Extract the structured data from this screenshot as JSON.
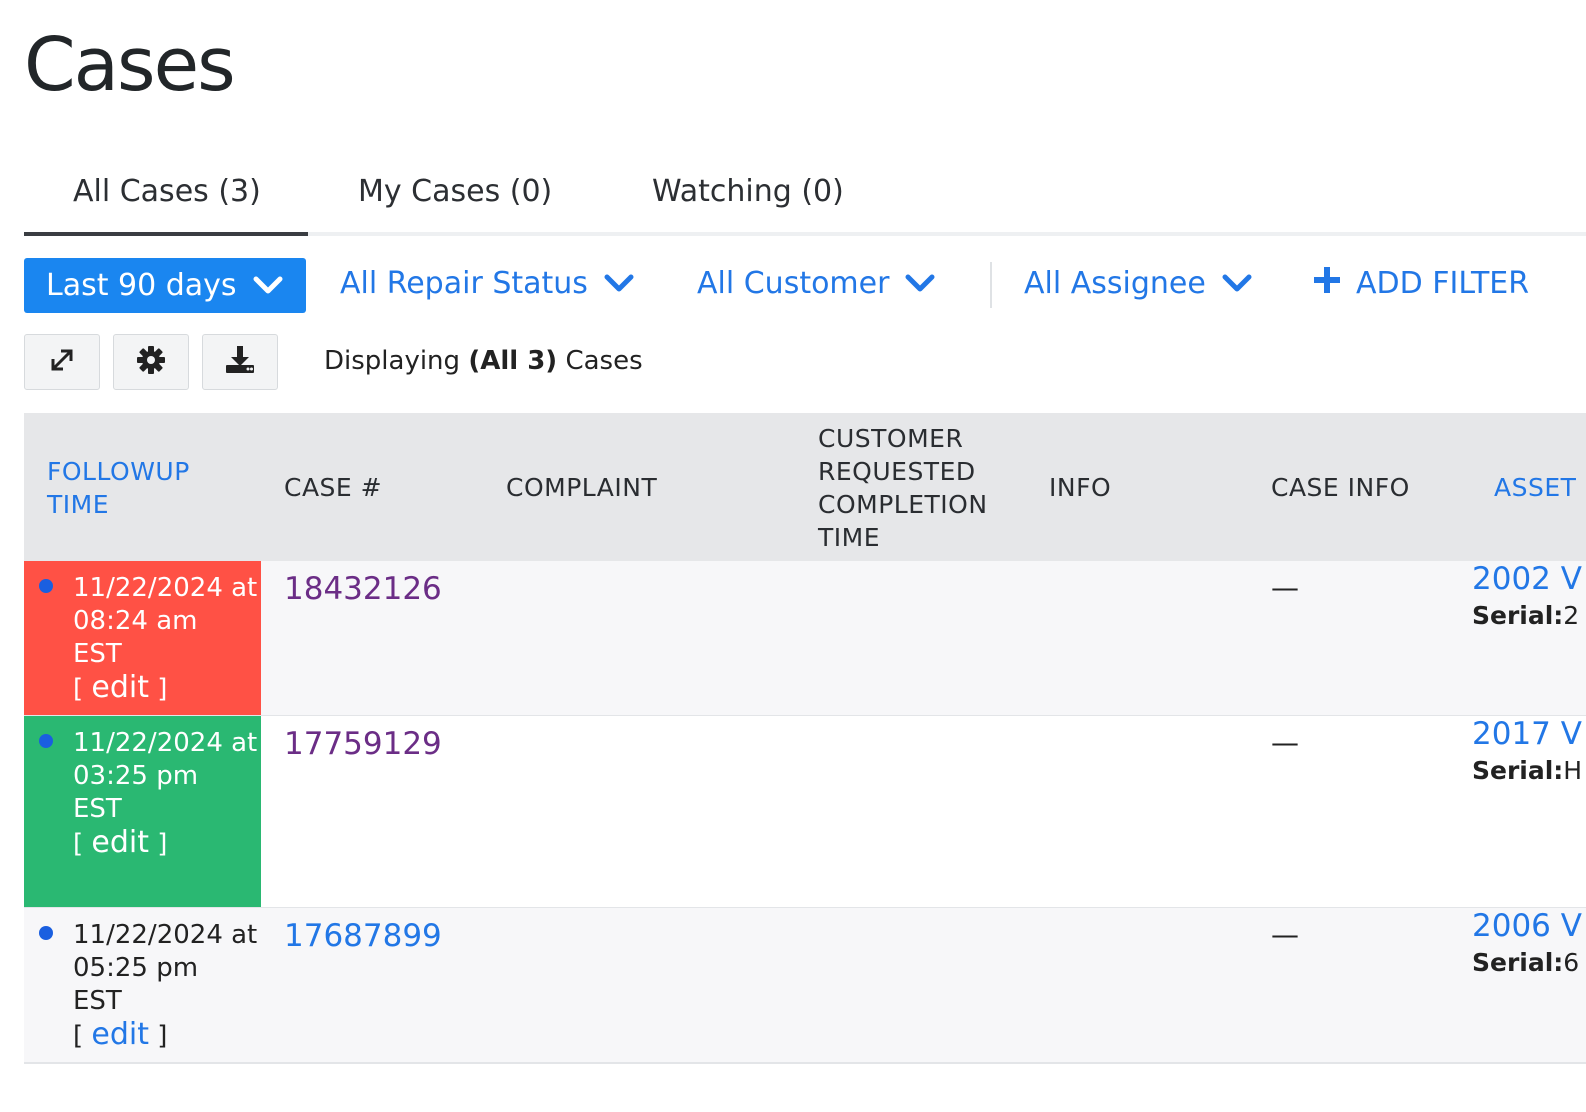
{
  "page": {
    "title": "Cases"
  },
  "tabs": [
    {
      "label": "All Cases (3)",
      "active": true
    },
    {
      "label": "My Cases (0)",
      "active": false
    },
    {
      "label": "Watching (0)",
      "active": false
    }
  ],
  "filters": {
    "date_range": "Last 90 days",
    "repair_status": "All Repair Status",
    "customer": "All Customer",
    "assignee": "All Assignee",
    "add_filter": "ADD FILTER"
  },
  "toolbar": {
    "display_prefix": "Displaying",
    "display_count": "(All 3)",
    "display_suffix": "Cases",
    "buttons": [
      "expand-icon",
      "gear-icon",
      "download-icon"
    ]
  },
  "table": {
    "headers": {
      "followup": [
        "FOLLOWUP",
        "TIME"
      ],
      "case_no": "CASE #",
      "complaint": "COMPLAINT",
      "requested": [
        "CUSTOMER",
        "REQUESTED",
        "COMPLETION",
        "TIME"
      ],
      "info": "INFO",
      "case_info": "CASE INFO",
      "asset": "ASSET"
    },
    "rows": [
      {
        "followup_date": "11/22/2024 at",
        "followup_time": "08:24 am",
        "followup_tz": "EST",
        "edit_label": "edit",
        "case_no": "18432126",
        "case_info": "—",
        "asset": "2002 V",
        "serial_label": "Serial:",
        "serial_value": "2",
        "status_color": "#ff5145",
        "case_color": "#6b2d86"
      },
      {
        "followup_date": "11/22/2024 at",
        "followup_time": "03:25 pm",
        "followup_tz": "EST",
        "edit_label": "edit",
        "case_no": "17759129",
        "case_info": "—",
        "asset": "2017 V",
        "serial_label": "Serial:",
        "serial_value": "H",
        "status_color": "#2ab872",
        "case_color": "#6b2d86"
      },
      {
        "followup_date": "11/22/2024 at",
        "followup_time": "05:25 pm",
        "followup_tz": "EST",
        "edit_label": "edit",
        "case_no": "17687899",
        "case_info": "—",
        "asset": "2006 V",
        "serial_label": "Serial:",
        "serial_value": "6",
        "status_color": "#f7f7f9",
        "case_color": "#2277e6"
      }
    ]
  },
  "colors": {
    "primary": "#1a86f0",
    "link": "#2277e6",
    "overdue": "#ff5145",
    "ok": "#2ab872",
    "visited": "#6b2d86"
  }
}
